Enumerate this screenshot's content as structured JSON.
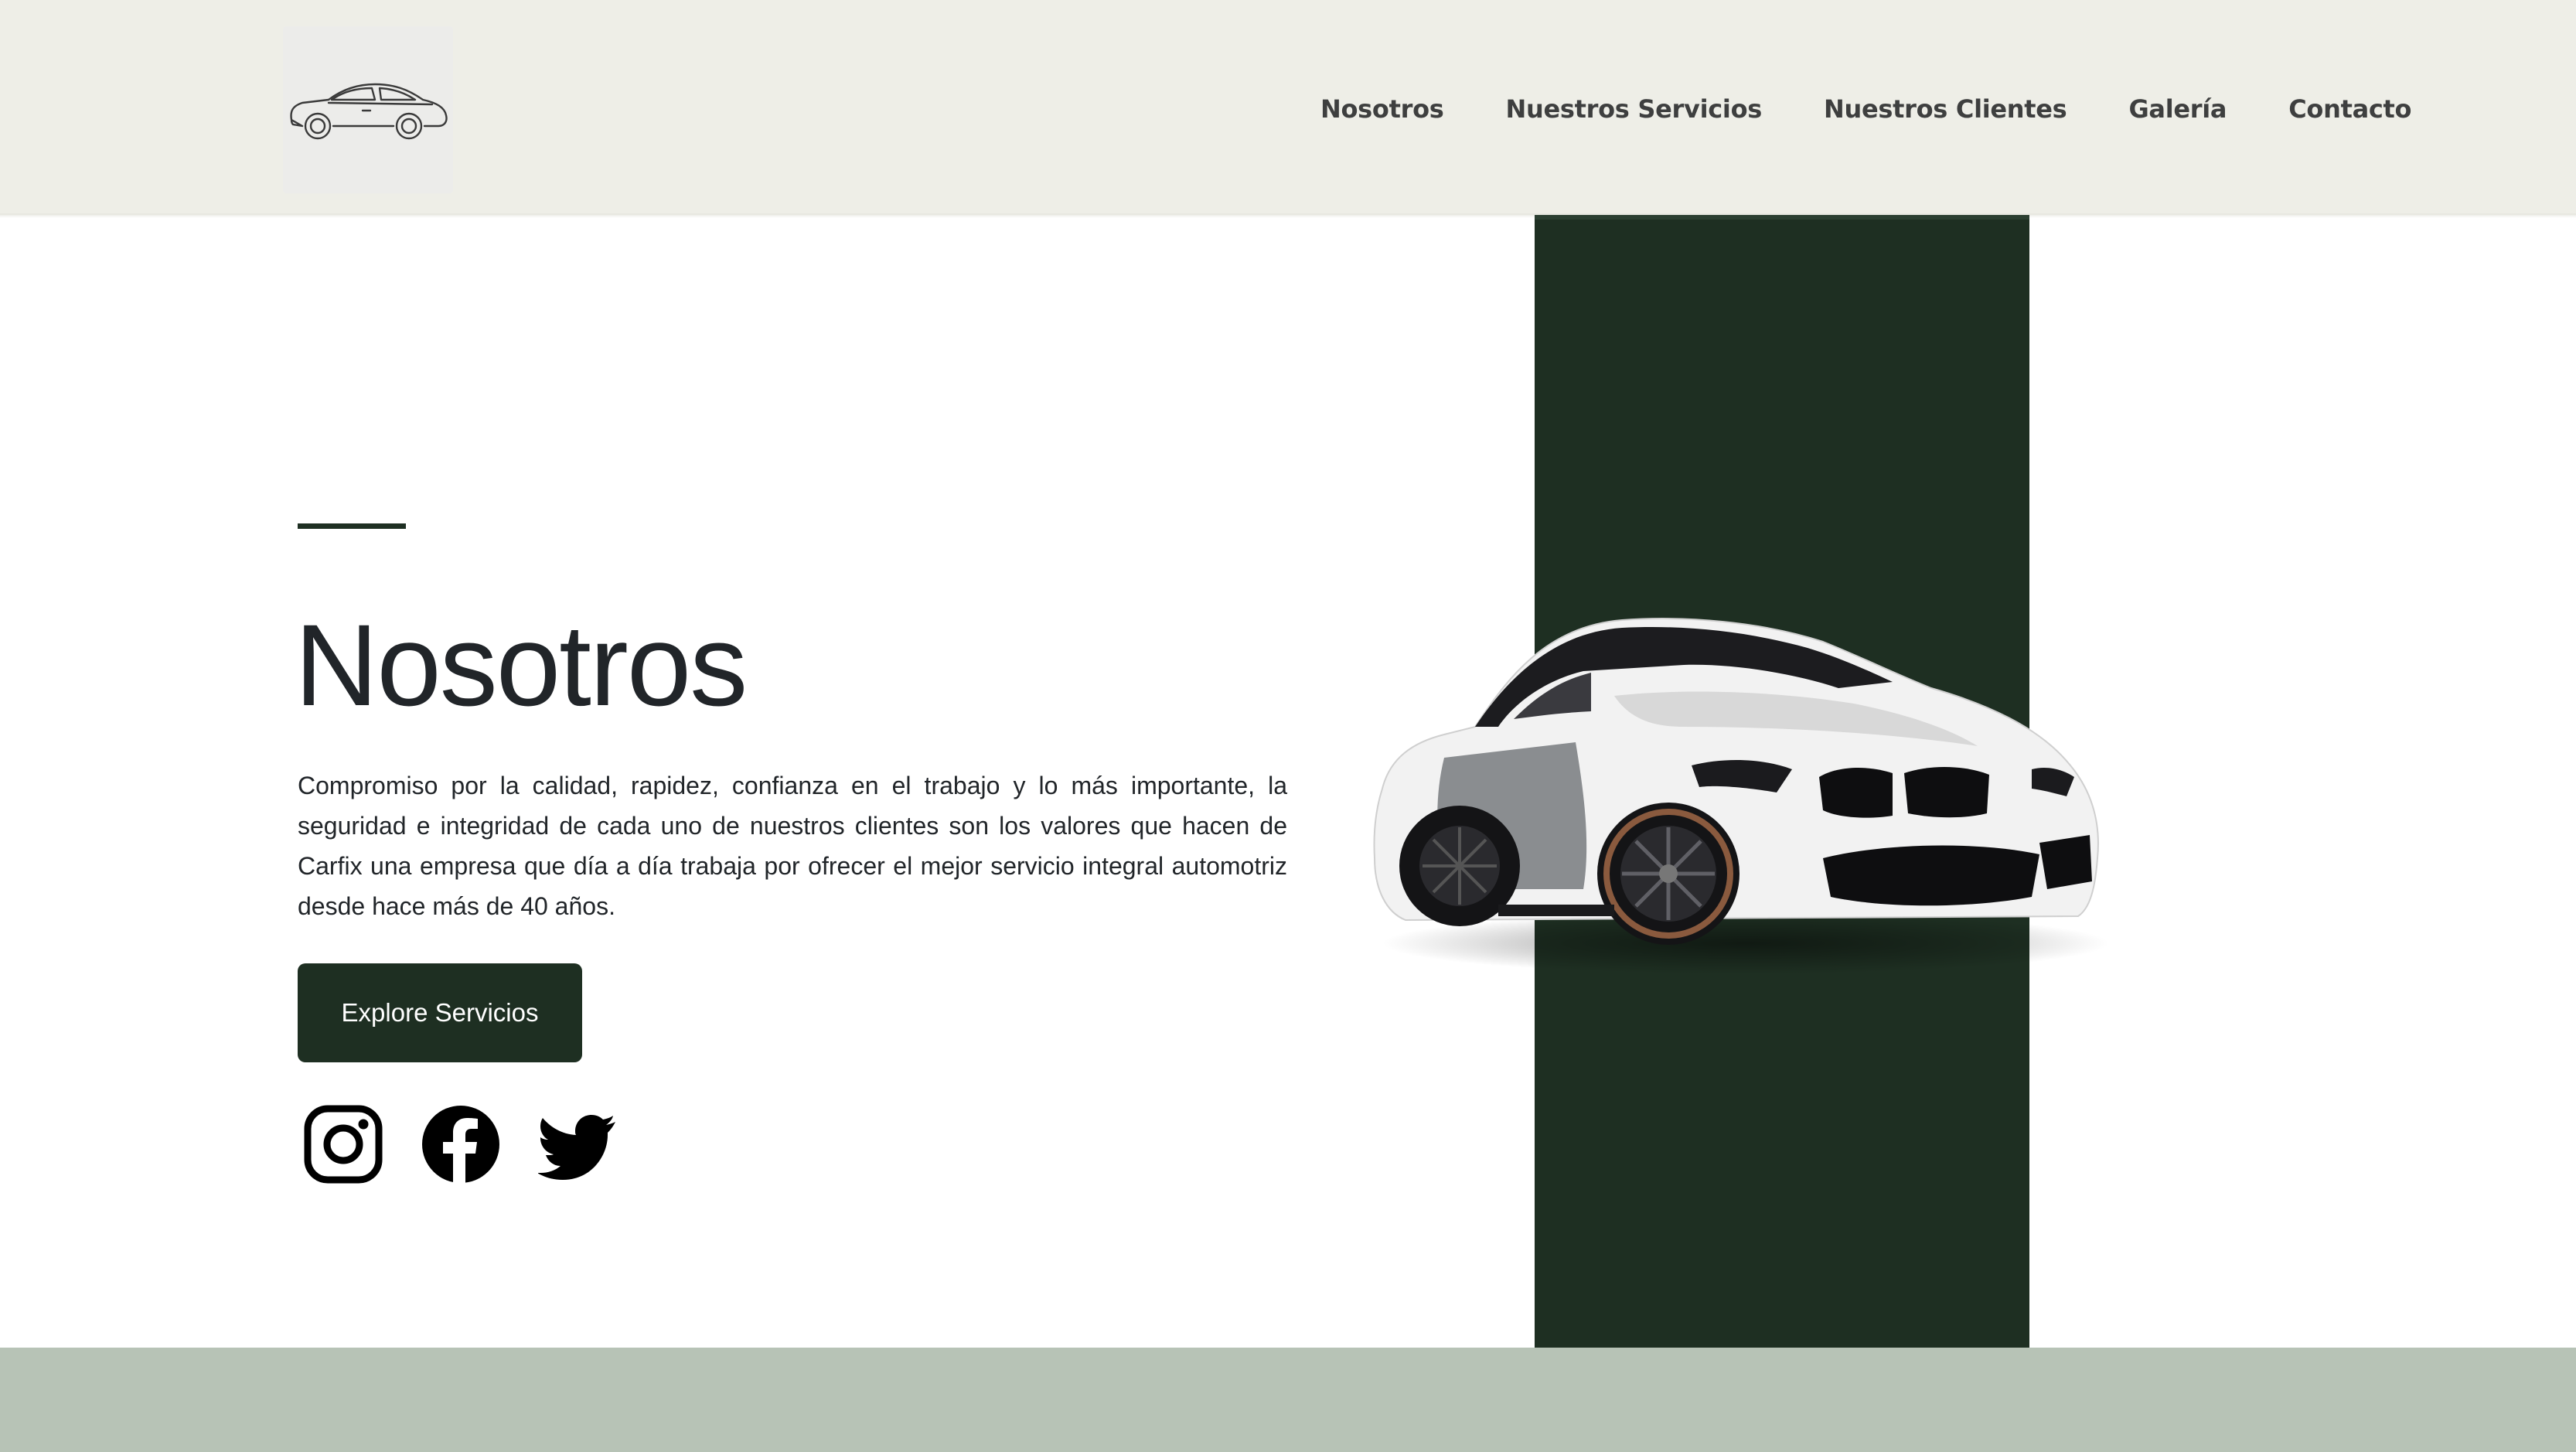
{
  "header": {
    "logo_icon": "car-outline-logo",
    "nav": [
      {
        "label": "Nosotros"
      },
      {
        "label": "Nuestros Servicios"
      },
      {
        "label": "Nuestros Clientes"
      },
      {
        "label": "Galería"
      },
      {
        "label": "Contacto"
      }
    ]
  },
  "hero": {
    "title": "Nosotros",
    "description": "Compromiso por la calidad, rapidez, confianza en el trabajo y lo más importante, la seguridad e integridad de cada uno de nuestros clientes son los valores que hacen de Carfix una empresa que día a día trabaja por ofrecer el mejor servicio integral automotriz desde hace más de 40 años.",
    "cta_label": "Explore Servicios",
    "social": [
      {
        "icon": "instagram-icon"
      },
      {
        "icon": "facebook-icon"
      },
      {
        "icon": "twitter-icon"
      }
    ],
    "image": "white-sports-car"
  },
  "colors": {
    "header_bg": "#eeeee7",
    "accent_dark_green": "#1e2f22",
    "footer_strip": "#b7c3b6",
    "nav_text": "#3e3f3f",
    "body_text": "#212529"
  }
}
